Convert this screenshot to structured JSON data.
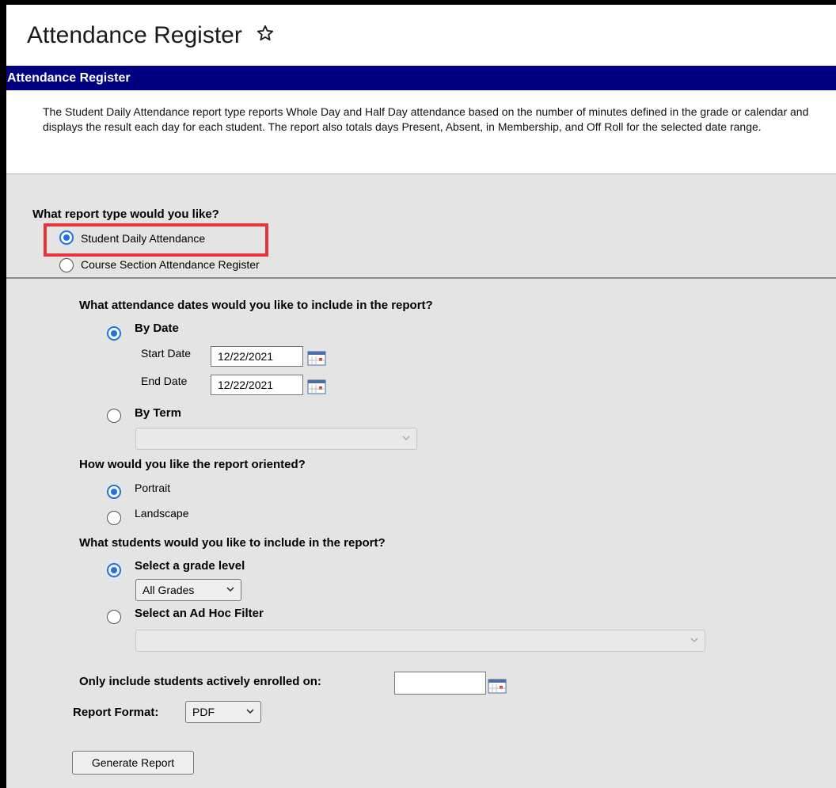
{
  "page": {
    "title": "Attendance Register",
    "star_icon": "star-outline-icon",
    "banner": "Attendance Register",
    "description": "The Student Daily Attendance report type reports Whole Day and Half Day attendance based on the number of minutes defined in the grade or calendar and displays the result each day for each student. The report also totals days Present, Absent, in Membership, and Off Roll for the selected date range."
  },
  "report_type": {
    "question": "What report type would you like?",
    "options": [
      "Student Daily Attendance",
      "Course Section Attendance Register"
    ],
    "selected": "Student Daily Attendance"
  },
  "dates": {
    "question": "What attendance dates would you like to include in the report?",
    "by_date_label": "By Date",
    "start_label": "Start Date",
    "start_value": "12/22/2021",
    "end_label": "End Date",
    "end_value": "12/22/2021",
    "by_term_label": "By Term",
    "term_value": "",
    "selected": "By Date"
  },
  "orientation": {
    "question": "How would you like the report oriented?",
    "portrait_label": "Portrait",
    "landscape_label": "Landscape",
    "selected": "Portrait"
  },
  "students": {
    "question": "What students would you like to include in the report?",
    "grade_label": "Select a grade level",
    "grade_value": "All Grades",
    "adhoc_label": "Select an Ad Hoc Filter",
    "adhoc_value": "",
    "selected": "Select a grade level"
  },
  "enrolled": {
    "label": "Only include students actively enrolled on:",
    "value": ""
  },
  "format": {
    "label": "Report Format:",
    "value": "PDF"
  },
  "generate_button": "Generate Report",
  "colors": {
    "banner": "#000080",
    "highlight": "#e8353c",
    "radio_accent": "#1a73e8"
  }
}
